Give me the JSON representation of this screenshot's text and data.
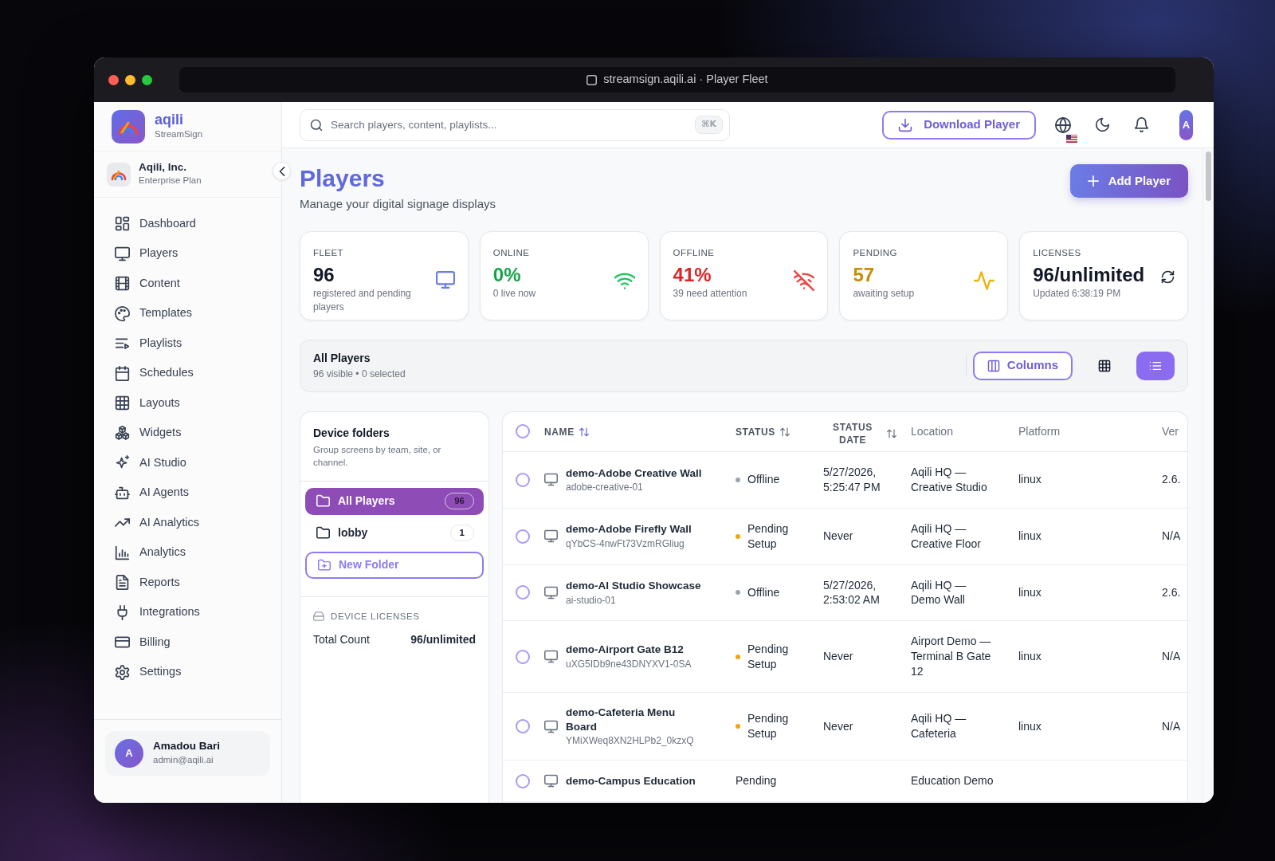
{
  "browser": {
    "title": "streamsign.aqili.ai · Player Fleet"
  },
  "sidebar": {
    "brand": {
      "name": "aqili",
      "product": "StreamSign"
    },
    "organization": {
      "name": "Aqili, Inc.",
      "plan": "Enterprise Plan"
    },
    "items": [
      {
        "label": "Dashboard",
        "selected": false
      },
      {
        "label": "Players",
        "selected": false
      },
      {
        "label": "Content",
        "selected": false
      },
      {
        "label": "Templates",
        "selected": false
      },
      {
        "label": "Playlists",
        "selected": false
      },
      {
        "label": "Schedules",
        "selected": false
      },
      {
        "label": "Layouts",
        "selected": false
      },
      {
        "label": "Widgets",
        "selected": false
      },
      {
        "label": "AI Studio",
        "selected": false
      },
      {
        "label": "AI Agents",
        "selected": false
      },
      {
        "label": "AI Analytics",
        "selected": false
      },
      {
        "label": "Analytics",
        "selected": false
      },
      {
        "label": "Reports",
        "selected": false
      },
      {
        "label": "Integrations",
        "selected": false
      },
      {
        "label": "Billing",
        "selected": false
      },
      {
        "label": "Settings",
        "selected": false
      }
    ],
    "user": {
      "initial": "A",
      "name": "Amadou Bari",
      "email": "admin@aqili.ai"
    }
  },
  "topbar": {
    "search": {
      "placeholder": "Search players, content, playlists...",
      "shortcut": "⌘K"
    },
    "download_button": "Download Player",
    "avatar": "A"
  },
  "header": {
    "title": "Players",
    "subtitle": "Manage your digital signage displays",
    "add_button": "Add Player"
  },
  "stats": [
    {
      "kind": "fleet",
      "label": "FLEET",
      "value": "96",
      "caption": "registered and pending players",
      "color": "#111827"
    },
    {
      "kind": "online",
      "label": "ONLINE",
      "value": "0%",
      "caption": "0 live now",
      "color": "#16a34a"
    },
    {
      "kind": "offline",
      "label": "OFFLINE",
      "value": "41%",
      "caption": "39 need attention",
      "color": "#dc2626"
    },
    {
      "kind": "pending",
      "label": "PENDING",
      "value": "57",
      "caption": "awaiting setup",
      "color": "#ca8a04"
    },
    {
      "kind": "licenses",
      "label": "LICENSES",
      "value": "96/unlimited",
      "caption": "Updated 6:38:19 PM",
      "color": "#111827"
    }
  ],
  "toolbar": {
    "title": "All Players",
    "summary": "96 visible • 0 selected",
    "columns_button": "Columns",
    "views": [
      {
        "kind": "grid",
        "selected": false
      },
      {
        "kind": "list",
        "selected": true
      }
    ]
  },
  "folders": {
    "title": "Device folders",
    "description": "Group screens by team, site, or channel.",
    "items": [
      {
        "name": "All Players",
        "count": "96",
        "selected": true
      },
      {
        "name": "lobby",
        "count": "1",
        "selected": false
      }
    ],
    "new_folder_button": "New Folder",
    "licenses": {
      "title": "DEVICE LICENSES",
      "label": "Total Count",
      "value": "96/unlimited"
    }
  },
  "table": {
    "all_selected": false,
    "columns": [
      {
        "label": "NAME",
        "kind": "sortable",
        "sorted": true
      },
      {
        "label": "STATUS",
        "kind": "sortable",
        "sorted": false
      },
      {
        "label": "STATUS DATE",
        "kind": "sortable",
        "sorted": false
      },
      {
        "label": "Location",
        "kind": "plain"
      },
      {
        "label": "Platform",
        "kind": "plain"
      },
      {
        "label": "Ver",
        "kind": "plain"
      }
    ],
    "rows": [
      {
        "selected": false,
        "name": "demo-Adobe Creative Wall",
        "device_id": "adobe-creative-01",
        "status": "Offline",
        "color": "#9ca3af",
        "status_date": "5/27/2026, 5:25:47 PM",
        "location": "Aqili HQ — Creative Studio",
        "platform": "linux",
        "version": "2.6."
      },
      {
        "selected": false,
        "name": "demo-Adobe Firefly Wall",
        "device_id": "qYbCS-4nwFt73VzmRGliug",
        "status": "Pending Setup",
        "color": "#f5a30b",
        "status_date": "Never",
        "location": "Aqili HQ — Creative Floor",
        "platform": "linux",
        "version": "N/A"
      },
      {
        "selected": false,
        "name": "demo-AI Studio Showcase",
        "device_id": "ai-studio-01",
        "status": "Offline",
        "color": "#9ca3af",
        "status_date": "5/27/2026, 2:53:02 AM",
        "location": "Aqili HQ — Demo Wall",
        "platform": "linux",
        "version": "2.6."
      },
      {
        "selected": false,
        "name": "demo-Airport Gate B12",
        "device_id": "uXG5IDb9ne43DNYXV1-0SA",
        "status": "Pending Setup",
        "color": "#f5a30b",
        "status_date": "Never",
        "location": "Airport Demo — Terminal B Gate 12",
        "platform": "linux",
        "version": "N/A"
      },
      {
        "selected": false,
        "name": "demo-Cafeteria Menu Board",
        "device_id": "YMiXWeq8XN2HLPb2_0kzxQ",
        "status": "Pending Setup",
        "color": "#f5a30b",
        "status_date": "Never",
        "location": "Aqili HQ — Cafeteria",
        "platform": "linux",
        "version": "N/A"
      },
      {
        "selected": false,
        "name": "demo-Campus Education",
        "status": "Pending",
        "location": "Education Demo"
      }
    ]
  }
}
